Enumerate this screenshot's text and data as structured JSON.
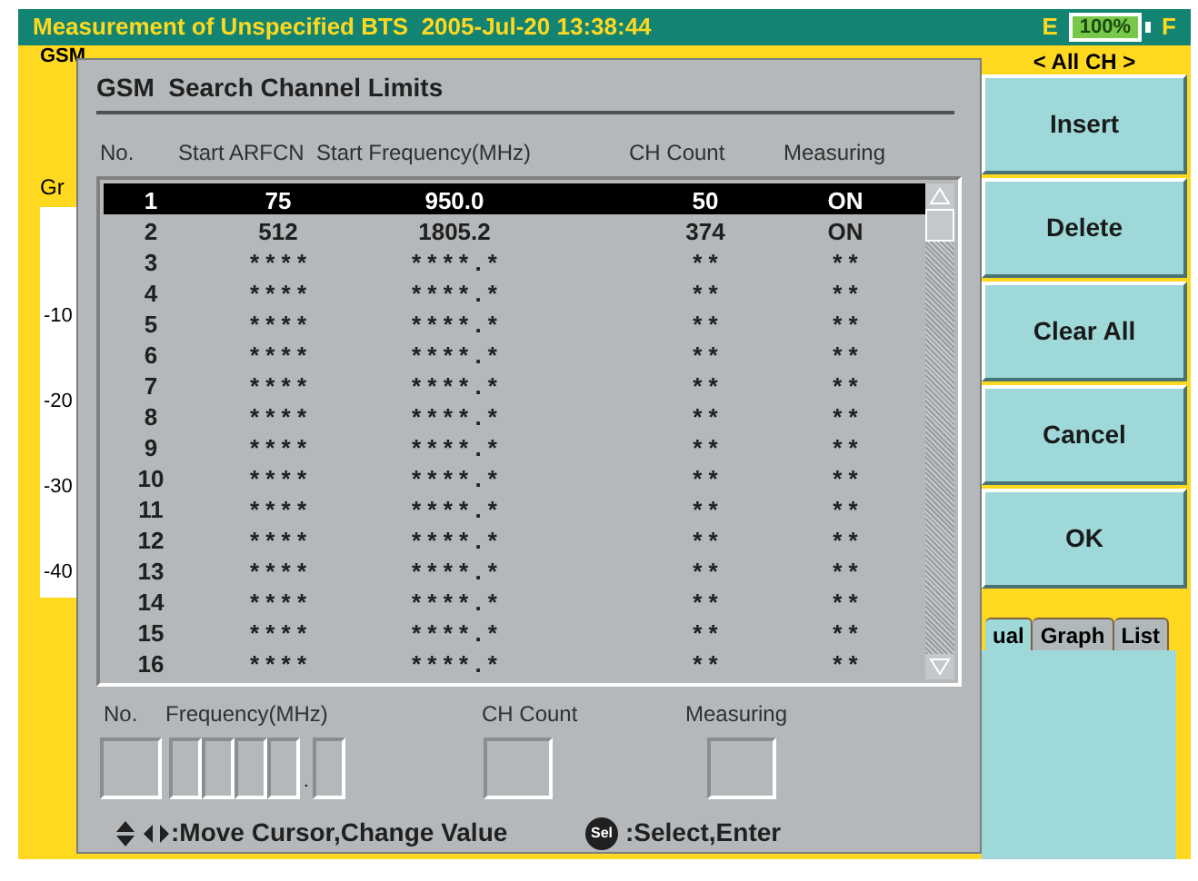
{
  "title_bar": {
    "title": "Measurement of Unspecified BTS  2005-Jul-20 13:38:44",
    "battery_left": "E",
    "battery": "100%",
    "battery_right": "F"
  },
  "background": {
    "mode": "GSM",
    "graph_label": "Gr",
    "y_labels": [
      "-10",
      "-20",
      "-30",
      "-40"
    ]
  },
  "softkeys": {
    "header": "< All CH >",
    "buttons": [
      "Insert",
      "Delete",
      "Clear All",
      "Cancel",
      "OK"
    ]
  },
  "view_tabs": [
    {
      "label": "ual",
      "selected": true
    },
    {
      "label": "Graph",
      "selected": false
    },
    {
      "label": "List",
      "selected": false
    }
  ],
  "dialog": {
    "title": "GSM  Search Channel Limits",
    "columns": [
      "No.",
      "Start ARFCN",
      "Start Frequency(MHz)",
      "CH Count",
      "Measuring"
    ],
    "rows": [
      {
        "no": "1",
        "arfcn": "75",
        "frequency": "950.0",
        "count": "50",
        "measuring": "ON",
        "selected": true
      },
      {
        "no": "2",
        "arfcn": "512",
        "frequency": "1805.2",
        "count": "374",
        "measuring": "ON",
        "selected": false
      },
      {
        "no": "3",
        "arfcn": "* * * *",
        "frequency": "* * * * . *",
        "count": "* *",
        "measuring": "* *",
        "selected": false
      },
      {
        "no": "4",
        "arfcn": "* * * *",
        "frequency": "* * * * . *",
        "count": "* *",
        "measuring": "* *",
        "selected": false
      },
      {
        "no": "5",
        "arfcn": "* * * *",
        "frequency": "* * * * . *",
        "count": "* *",
        "measuring": "* *",
        "selected": false
      },
      {
        "no": "6",
        "arfcn": "* * * *",
        "frequency": "* * * * . *",
        "count": "* *",
        "measuring": "* *",
        "selected": false
      },
      {
        "no": "7",
        "arfcn": "* * * *",
        "frequency": "* * * * . *",
        "count": "* *",
        "measuring": "* *",
        "selected": false
      },
      {
        "no": "8",
        "arfcn": "* * * *",
        "frequency": "* * * * . *",
        "count": "* *",
        "measuring": "* *",
        "selected": false
      },
      {
        "no": "9",
        "arfcn": "* * * *",
        "frequency": "* * * * . *",
        "count": "* *",
        "measuring": "* *",
        "selected": false
      },
      {
        "no": "10",
        "arfcn": "* * * *",
        "frequency": "* * * * . *",
        "count": "* *",
        "measuring": "* *",
        "selected": false
      },
      {
        "no": "11",
        "arfcn": "* * * *",
        "frequency": "* * * * . *",
        "count": "* *",
        "measuring": "* *",
        "selected": false
      },
      {
        "no": "12",
        "arfcn": "* * * *",
        "frequency": "* * * * . *",
        "count": "* *",
        "measuring": "* *",
        "selected": false
      },
      {
        "no": "13",
        "arfcn": "* * * *",
        "frequency": "* * * * . *",
        "count": "* *",
        "measuring": "* *",
        "selected": false
      },
      {
        "no": "14",
        "arfcn": "* * * *",
        "frequency": "* * * * . *",
        "count": "* *",
        "measuring": "* *",
        "selected": false
      },
      {
        "no": "15",
        "arfcn": "* * * *",
        "frequency": "* * * * . *",
        "count": "* *",
        "measuring": "* *",
        "selected": false
      },
      {
        "no": "16",
        "arfcn": "* * * *",
        "frequency": "* * * * . *",
        "count": "* *",
        "measuring": "* *",
        "selected": false
      }
    ],
    "editor": {
      "no_label": "No.",
      "frequency_label": "Frequency(MHz)",
      "frequency_dot": ".",
      "count_label": "CH Count",
      "measuring_label": "Measuring"
    },
    "help": {
      "move": ":Move Cursor,Change Value",
      "select_key": "Sel",
      "select": ":Select,Enter"
    }
  }
}
